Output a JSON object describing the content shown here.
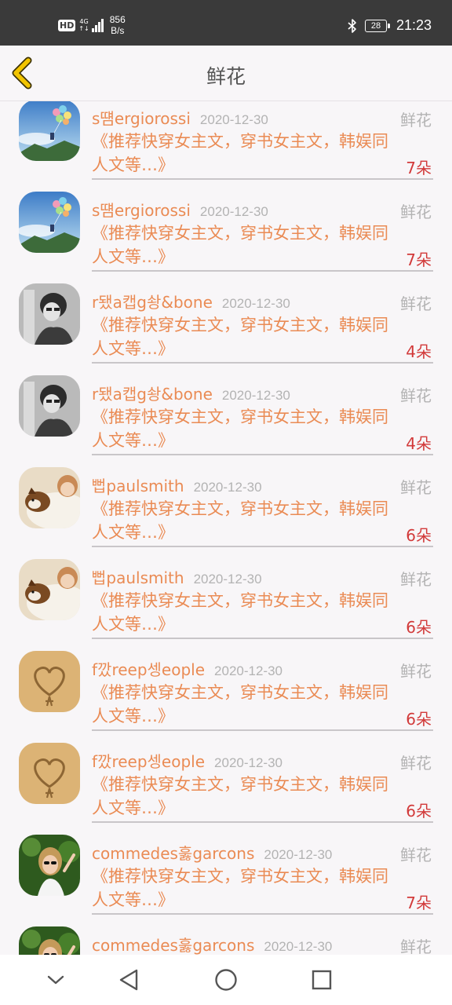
{
  "status_bar": {
    "hd": "HD",
    "network": "4G",
    "network_sub": "↑↓",
    "speed_value": "856",
    "speed_unit": "B/s",
    "battery": "28",
    "time": "21:23"
  },
  "header": {
    "title": "鲜花",
    "back_icon": "chevron-left-icon"
  },
  "gifts": [
    {
      "user": "s떔ergiorossi",
      "time": "2020-12-30",
      "type": "鲜花",
      "book": "《推荐快穿女主文，穿书女主文，韩娱同人文等…》",
      "count": "7朵",
      "avatar": "balloon"
    },
    {
      "user": "s떔ergiorossi",
      "time": "2020-12-30",
      "type": "鲜花",
      "book": "《推荐快穿女主文，穿书女主文，韩娱同人文等…》",
      "count": "7朵",
      "avatar": "balloon"
    },
    {
      "user": "r됐a캡g솽&bone",
      "time": "2020-12-30",
      "type": "鲜花",
      "book": "《推荐快穿女主文，穿书女主文，韩娱同人文等…》",
      "count": "4朵",
      "avatar": "bw-portrait"
    },
    {
      "user": "r됐a캡g솽&bone",
      "time": "2020-12-30",
      "type": "鲜花",
      "book": "《推荐快穿女主文，穿书女主文，韩娱同人文等…》",
      "count": "4朵",
      "avatar": "bw-portrait"
    },
    {
      "user": "뻡paulsmith",
      "time": "2020-12-30",
      "type": "鲜花",
      "book": "《推荐快穿女主文，穿书女主文，韩娱同人文等…》",
      "count": "6朵",
      "avatar": "dog"
    },
    {
      "user": "뻡paulsmith",
      "time": "2020-12-30",
      "type": "鲜花",
      "book": "《推荐快穿女主文，穿书女主文，韩娱同人文等…》",
      "count": "6朵",
      "avatar": "dog"
    },
    {
      "user": "f깠reep셍eople",
      "time": "2020-12-30",
      "type": "鲜花",
      "book": "《推荐快穿女主文，穿书女主文，韩娱同人文等…》",
      "count": "6朵",
      "avatar": "sand-heart"
    },
    {
      "user": "f깠reep셍eople",
      "time": "2020-12-30",
      "type": "鲜花",
      "book": "《推荐快穿女主文，穿书女主文，韩娱同人文等…》",
      "count": "6朵",
      "avatar": "sand-heart"
    },
    {
      "user": "commedes훓garcons",
      "time": "2020-12-30",
      "type": "鲜花",
      "book": "《推荐快穿女主文，穿书女主文，韩娱同人文等…》",
      "count": "7朵",
      "avatar": "girl-sunglasses"
    },
    {
      "user": "commedes훓garcons",
      "time": "2020-12-30",
      "type": "鲜花",
      "book": "",
      "count": "",
      "avatar": "girl-sunglasses"
    }
  ],
  "nav_bar": {
    "icons": [
      "collapse-chevron-icon",
      "back-triangle-icon",
      "home-circle-icon",
      "recents-square-icon"
    ]
  },
  "colors": {
    "accent_orange": "#ea8b54",
    "count_red": "#d23a3a",
    "muted_gray": "#b3b3b3",
    "back_arrow": "#f2c400"
  }
}
